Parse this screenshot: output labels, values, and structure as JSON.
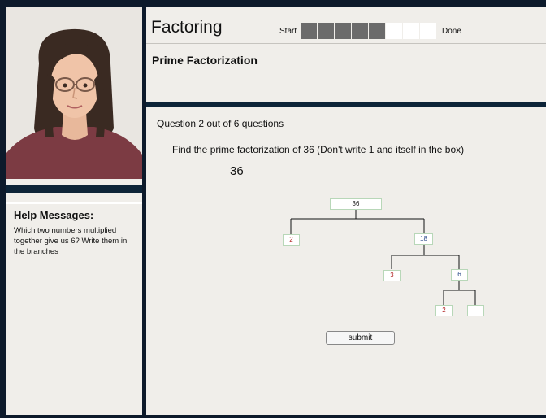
{
  "header": {
    "title": "Factoring",
    "progress_start_label": "Start",
    "progress_done_label": "Done",
    "progress": {
      "completed": 5,
      "total": 8
    },
    "subtitle": "Prime Factorization"
  },
  "help": {
    "title": "Help Messages:",
    "message": "Which two numbers multiplied together give us 6? Write them in the branches"
  },
  "question": {
    "count": "Question 2 out of 6 questions",
    "prompt": "Find the prime factorization of 36 (Don't write 1 and itself in the box)",
    "number": "36"
  },
  "tree": {
    "root": "36",
    "left": "2",
    "right": "18",
    "right_left": "3",
    "right_right": "6",
    "rr_left": "2",
    "rr_right": ""
  },
  "submit_label": "submit",
  "colors": {
    "background": "#0d1a2b",
    "panel": "#f0eeea",
    "progress_filled": "#6b6b6b"
  }
}
